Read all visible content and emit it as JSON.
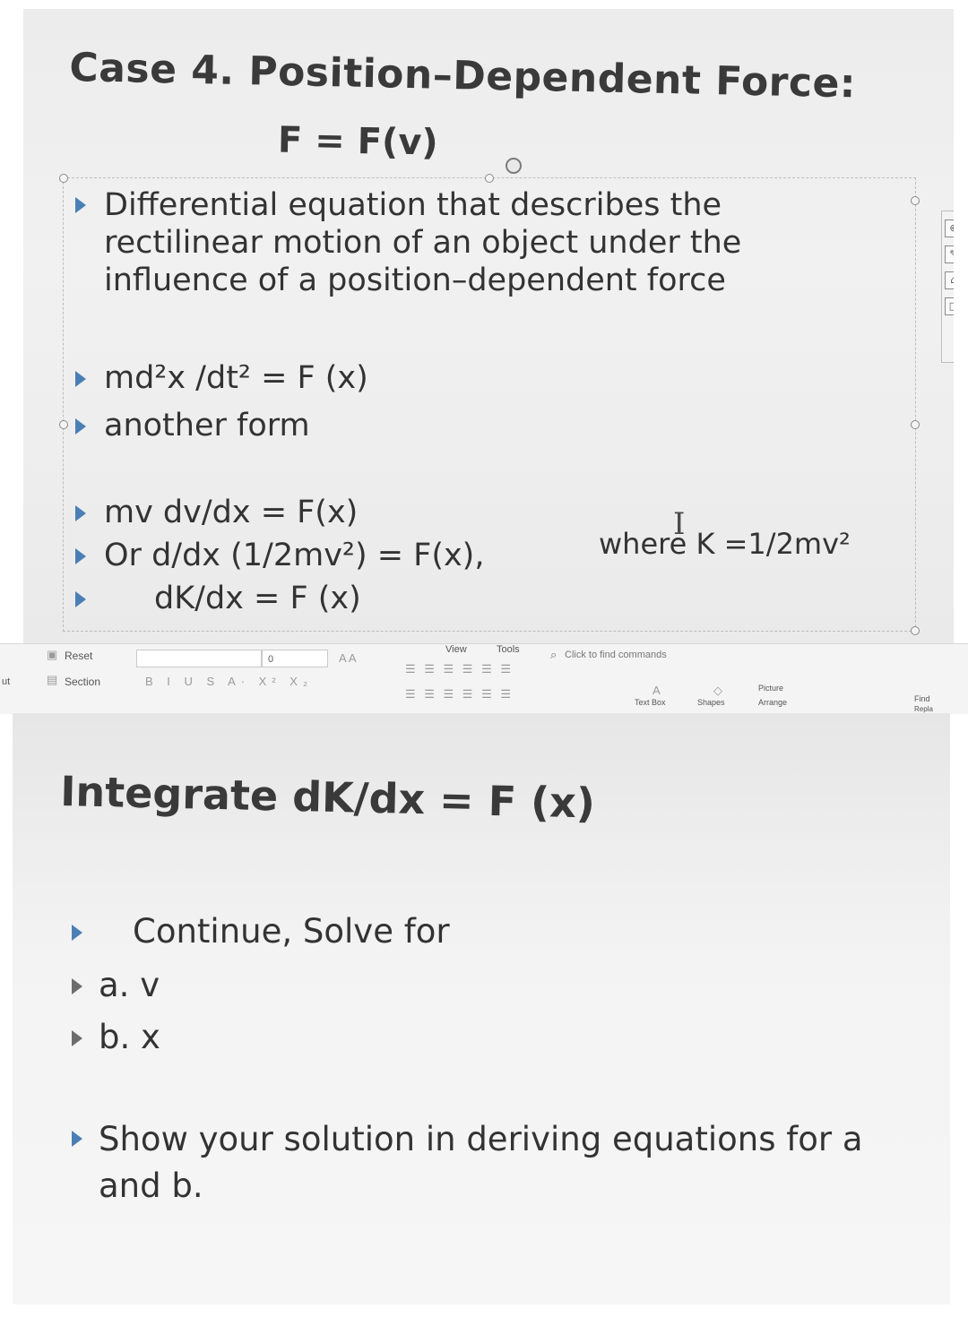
{
  "top_slide": {
    "title": "Case 4. Position–Dependent Force:",
    "subtitle": "F = F(v)",
    "bullets": [
      "Differential equation that describes the rectilinear motion of an object under the influence of a position–dependent force",
      "md²x /dt² = F (x)",
      "another form",
      "mv dv/dx = F(x)",
      "Or d/dx (1/2mv²) = F(x),",
      "dK/dx = F (x)"
    ],
    "where_note": "where K =1/2mv²",
    "side_tools": [
      "⊕",
      "✎",
      "⌂",
      "□"
    ]
  },
  "toolbar": {
    "reset_label": "Reset",
    "section_label": "Section",
    "font_size_value": "0",
    "view_tab": "View",
    "tools_tab": "Tools",
    "search_placeholder": "Click to find commands",
    "format_buttons": "B I U S A· X² X₂",
    "text_box_label": "Text Box",
    "shapes_label": "Shapes",
    "picture_label": "Picture",
    "arrange_label": "Arrange",
    "find_label": "Find",
    "replace_label": "Repla",
    "font_grow": "A A",
    "left_fragment": "ut"
  },
  "bottom_slide": {
    "title": "Integrate dK/dx = F (x)",
    "bullets": [
      "Continue, Solve for",
      "a. v",
      "b. x",
      "Show your solution in deriving equations for a and b."
    ]
  }
}
